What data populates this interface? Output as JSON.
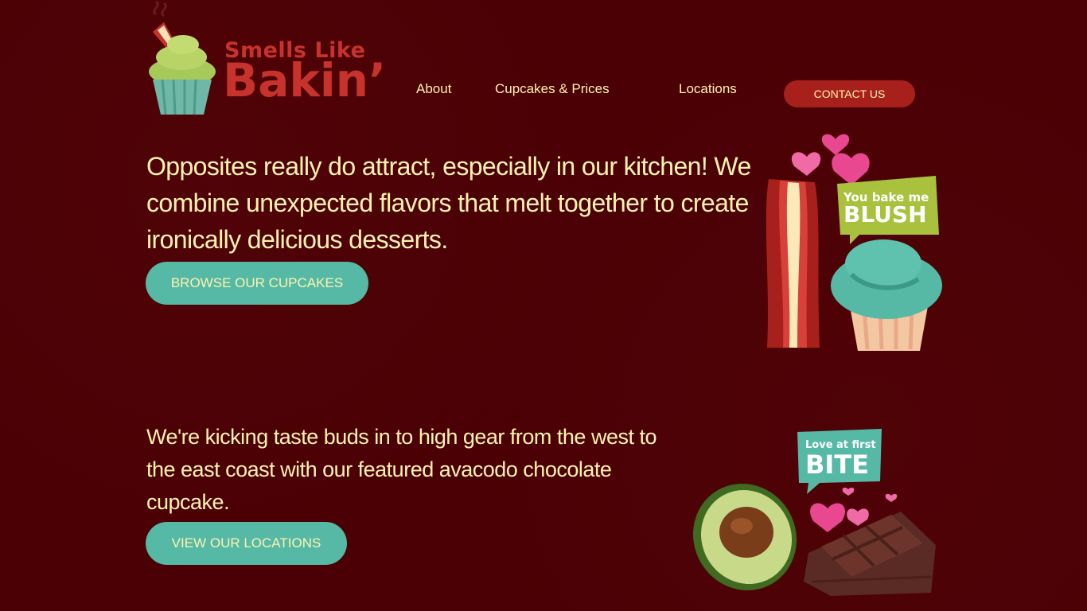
{
  "brand": {
    "line1": "Smells Like",
    "line2": "Bakin’"
  },
  "nav": {
    "items": [
      {
        "label": "About"
      },
      {
        "label": "Cupcakes & Prices"
      },
      {
        "label": "Locations"
      }
    ],
    "contact_label": "CONTACT US"
  },
  "sections": [
    {
      "text": "Opposites really do attract, especially in our kitchen! We combine unexpected flavors that melt together to create ironically delicious desserts.",
      "button_label": "BROWSE OUR CUPCAKES",
      "sticker": {
        "line1": "You bake me",
        "line2": "BLUSH"
      }
    },
    {
      "text": "We're kicking taste buds in to high gear from the west to the east coast with our featured avacodo chocolate cupcake.",
      "button_label": "VIEW OUR LOCATIONS",
      "sticker": {
        "line1": "Love at first",
        "line2": "BITE"
      }
    }
  ],
  "colors": {
    "background": "#4a0004",
    "brand_red": "#c7322d",
    "accent_teal": "#55b9a6",
    "text_cream": "#fff3b0",
    "contact_red": "#a8201c"
  },
  "icons": [
    "cupcake-bacon-logo-icon",
    "bacon-cupcake-illustration",
    "avocado-chocolate-illustration"
  ]
}
